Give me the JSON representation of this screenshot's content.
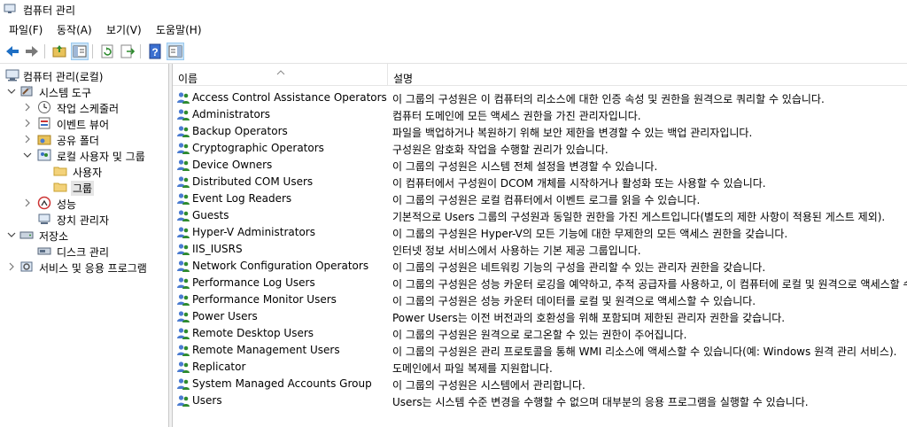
{
  "window": {
    "title": "컴퓨터 관리"
  },
  "menu": [
    "파일(F)",
    "동작(A)",
    "보기(V)",
    "도움말(H)"
  ],
  "toolbar": {
    "buttons": [
      "back-icon",
      "forward-icon",
      "up-folder-icon",
      "show-hide-tree-icon",
      "refresh-icon",
      "export-list-icon",
      "help-icon",
      "show-hide-action-pane-icon"
    ]
  },
  "tree": {
    "root": "컴퓨터 관리(로컬)",
    "system_tools": "시스템 도구",
    "task_scheduler": "작업 스케줄러",
    "event_viewer": "이벤트 뷰어",
    "shared_folders": "공유 폴더",
    "local_users_groups": "로컬 사용자 및 그룹",
    "users": "사용자",
    "groups": "그룹",
    "performance": "성능",
    "device_manager": "장치 관리자",
    "storage": "저장소",
    "disk_management": "디스크 관리",
    "services_apps": "서비스 및 응용 프로그램"
  },
  "list": {
    "columns": {
      "name": "이름",
      "description": "설명"
    },
    "rows": [
      {
        "name": "Access Control Assistance Operators",
        "description": "이 그룹의 구성원은 이 컴퓨터의 리소스에 대한 인증 속성 및 권한을 원격으로 쿼리할 수 있습니다."
      },
      {
        "name": "Administrators",
        "description": "컴퓨터 도메인에 모든 액세스 권한을 가진 관리자입니다."
      },
      {
        "name": "Backup Operators",
        "description": "파일을 백업하거나 복원하기 위해 보안 제한을 변경할 수 있는 백업 관리자입니다."
      },
      {
        "name": "Cryptographic Operators",
        "description": "구성원은 암호화 작업을 수행할 권리가 있습니다."
      },
      {
        "name": "Device Owners",
        "description": "이 그룹의 구성원은 시스템 전체 설정을 변경할 수 있습니다."
      },
      {
        "name": "Distributed COM Users",
        "description": "이 컴퓨터에서 구성원이 DCOM 개체를 시작하거나 활성화 또는 사용할 수 있습니다."
      },
      {
        "name": "Event Log Readers",
        "description": "이 그룹의 구성원은 로컬 컴퓨터에서 이벤트 로그를 읽을 수 있습니다."
      },
      {
        "name": "Guests",
        "description": "기본적으로 Users 그룹의 구성원과 동일한 권한을 가진 게스트입니다(별도의 제한 사항이 적용된 게스트 제외)."
      },
      {
        "name": "Hyper-V Administrators",
        "description": "이 그룹의 구성원은 Hyper-V의 모든 기능에 대한 무제한의 모든 액세스 권한을 갖습니다."
      },
      {
        "name": "IIS_IUSRS",
        "description": "인터넷 정보 서비스에서 사용하는 기본 제공 그룹입니다."
      },
      {
        "name": "Network Configuration Operators",
        "description": "이 그룹의 구성원은 네트워킹 기능의 구성을 관리할 수 있는 관리자 권한을 갖습니다."
      },
      {
        "name": "Performance Log Users",
        "description": "이 그룹의 구성원은 성능 카운터 로깅을 예약하고, 추적 공급자를 사용하고, 이 컴퓨터에 로컬 및 원격으로 액세스할 수 있습니다."
      },
      {
        "name": "Performance Monitor Users",
        "description": "이 그룹의 구성원은 성능 카운터 데이터를 로컬 및 원격으로 액세스할 수 있습니다."
      },
      {
        "name": "Power Users",
        "description": "Power Users는 이전 버전과의 호환성을 위해 포함되며 제한된 관리자 권한을 갖습니다."
      },
      {
        "name": "Remote Desktop Users",
        "description": "이 그룹의 구성원은 원격으로 로그온할 수 있는 권한이 주어집니다."
      },
      {
        "name": "Remote Management Users",
        "description": "이 그룹의 구성원은 관리 프로토콜을 통해 WMI 리소스에 액세스할 수 있습니다(예: Windows 원격 관리 서비스)."
      },
      {
        "name": "Replicator",
        "description": "도메인에서 파일 복제를 지원합니다."
      },
      {
        "name": "System Managed Accounts Group",
        "description": "이 그룹의 구성원은 시스템에서 관리합니다."
      },
      {
        "name": "Users",
        "description": "Users는 시스템 수준 변경을 수행할 수 없으며 대부분의 응용 프로그램을 실행할 수 있습니다."
      }
    ]
  },
  "colors": {
    "selection": "#e5e5e5",
    "border": "#c8c8c8",
    "icon_blue": "#1e6fc4"
  }
}
